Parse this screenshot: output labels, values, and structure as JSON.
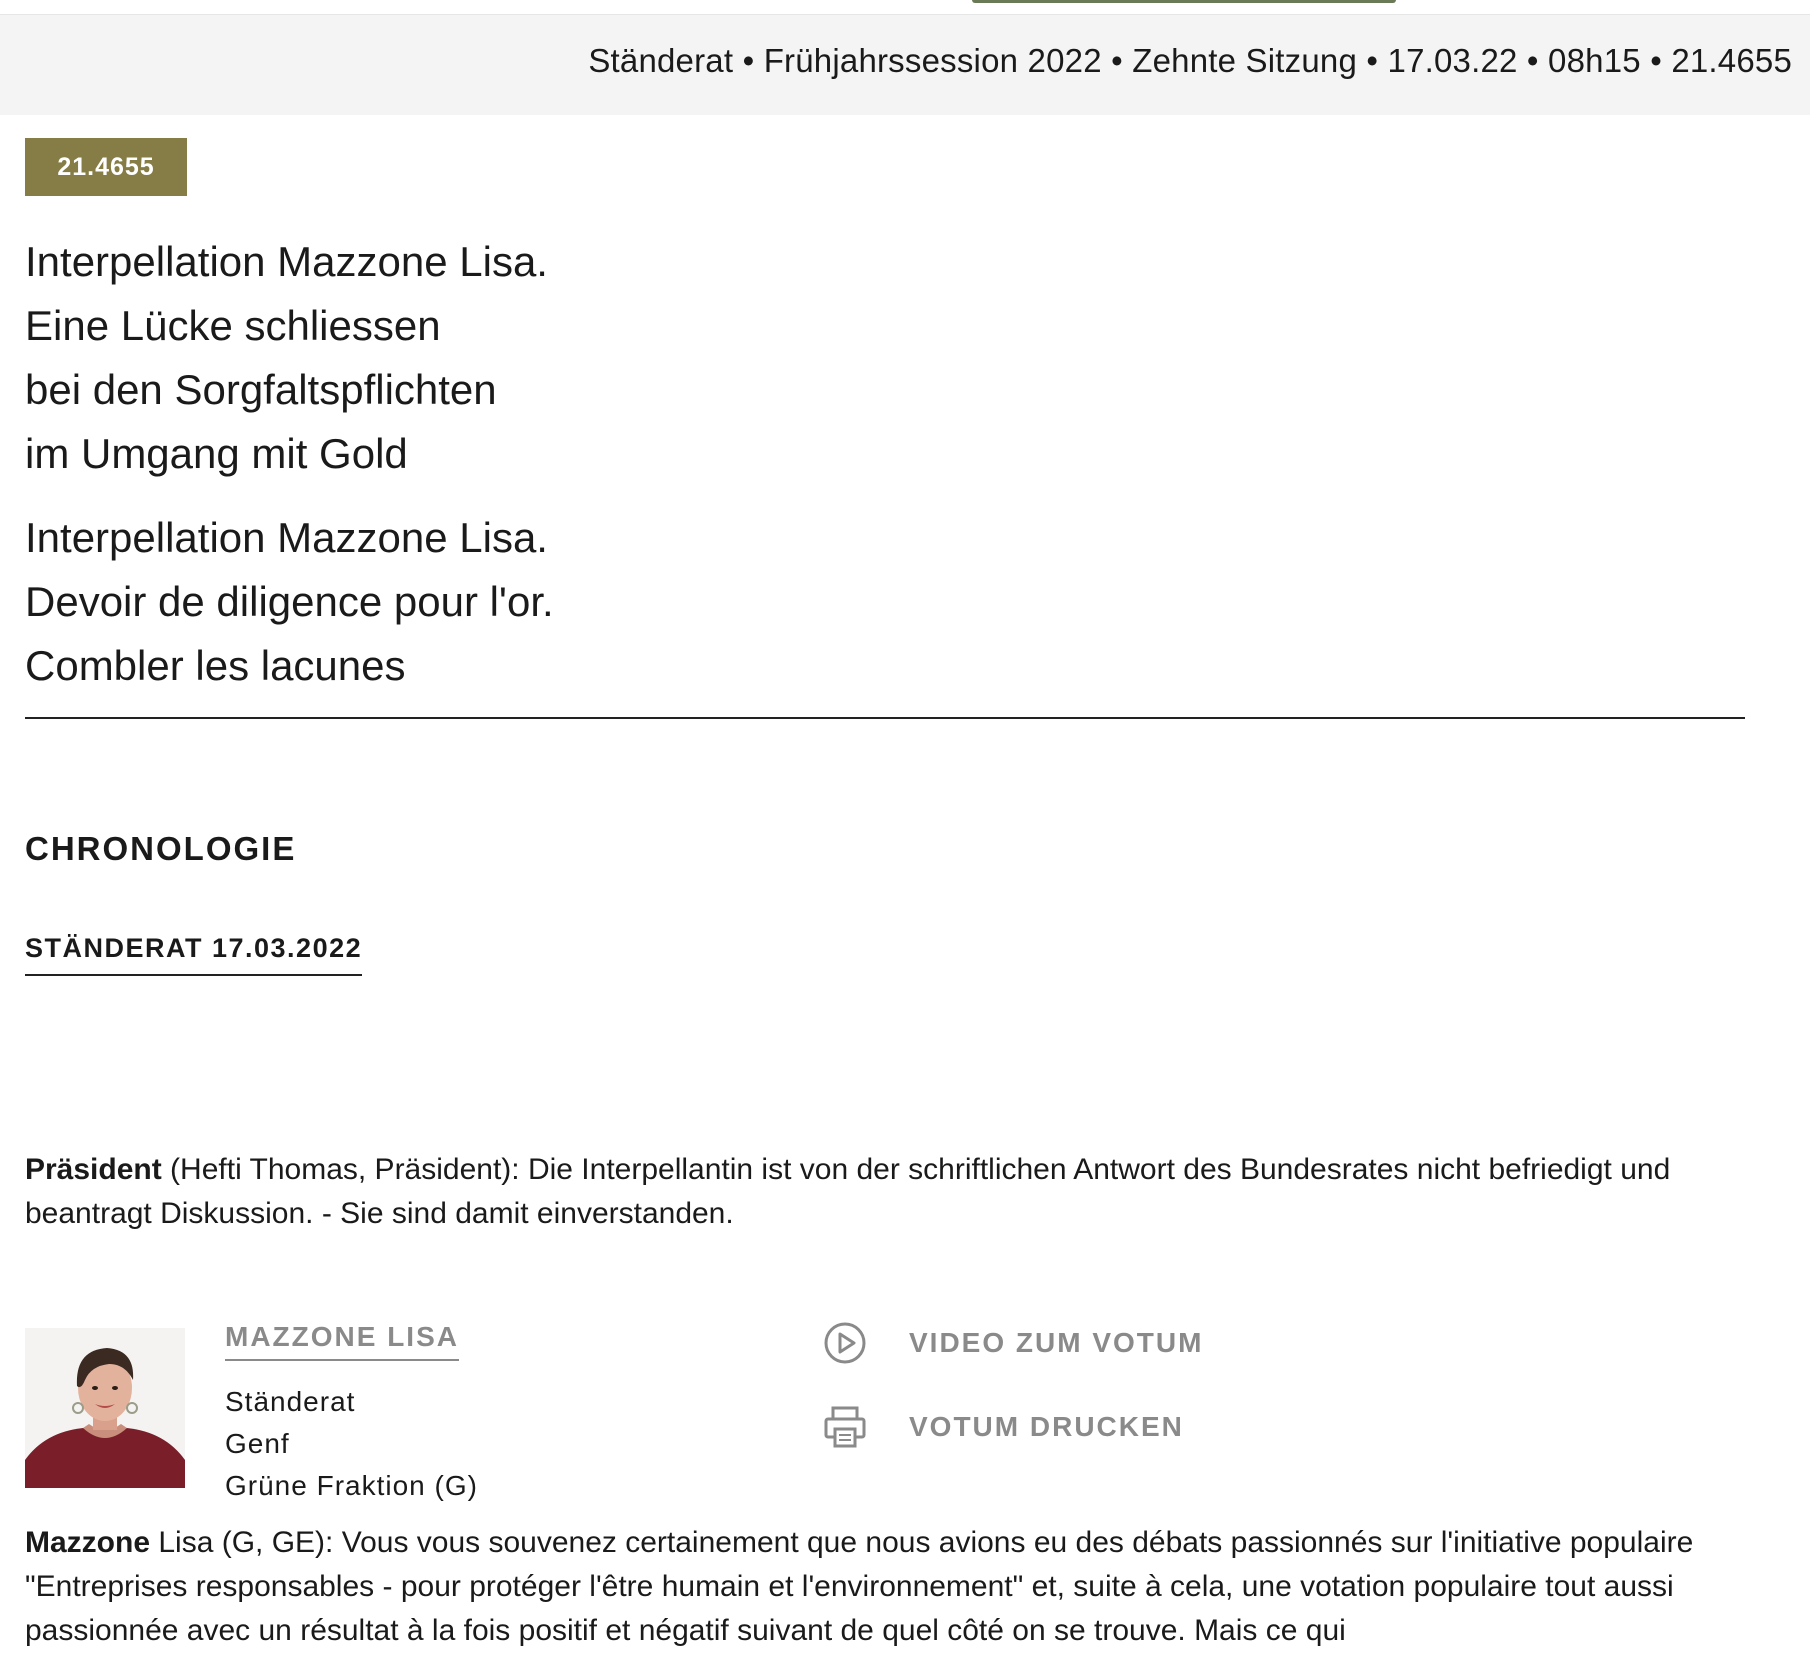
{
  "header": {
    "breadcrumb": "Ständerat • Frühjahrssession 2022 • Zehnte Sitzung • 17.03.22 • 08h15 • 21.4655"
  },
  "business": {
    "number": "21.4655",
    "title_de": [
      "Interpellation Mazzone Lisa.",
      "Eine Lücke schliessen",
      "bei den Sorgfaltspflichten",
      "im Umgang mit Gold"
    ],
    "title_fr": [
      "Interpellation Mazzone Lisa.",
      "Devoir de diligence pour l'or.",
      "Combler les lacunes"
    ]
  },
  "chronology": {
    "heading": "CHRONOLOGIE",
    "council_date": "STÄNDERAT 17.03.2022"
  },
  "president_statement": {
    "speaker": "Präsident",
    "text": " (Hefti Thomas, Präsident): Die Interpellantin ist von der schriftlichen Antwort des Bundesrates nicht befriedigt und beantragt Diskussion. - Sie sind damit einverstanden."
  },
  "speaker": {
    "name": "MAZZONE LISA",
    "council": "Ständerat",
    "canton": "Genf",
    "group": "Grüne Fraktion (G)",
    "avatar_icon": "portrait-photo"
  },
  "actions": {
    "video_label": "VIDEO ZUM VOTUM",
    "video_icon": "play-circle-icon",
    "print_label": "VOTUM DRUCKEN",
    "print_icon": "printer-icon"
  },
  "mazzone_statement": {
    "speaker": "Mazzone",
    "text": " Lisa (G, GE): Vous vous souvenez certainement que nous avions eu des débats passionnés sur l'initiative populaire \"Entreprises responsables - pour protéger l'être humain et l'environnement\" et, suite à cela, une votation populaire tout aussi passionnée avec un résultat à la fois positif et négatif suivant de quel côté on se trouve. Mais ce qui"
  },
  "colors": {
    "badge": "#857d45",
    "header_bg": "#f4f4f4",
    "muted": "#8a8a8a",
    "tab_accent": "#6b7a56"
  }
}
